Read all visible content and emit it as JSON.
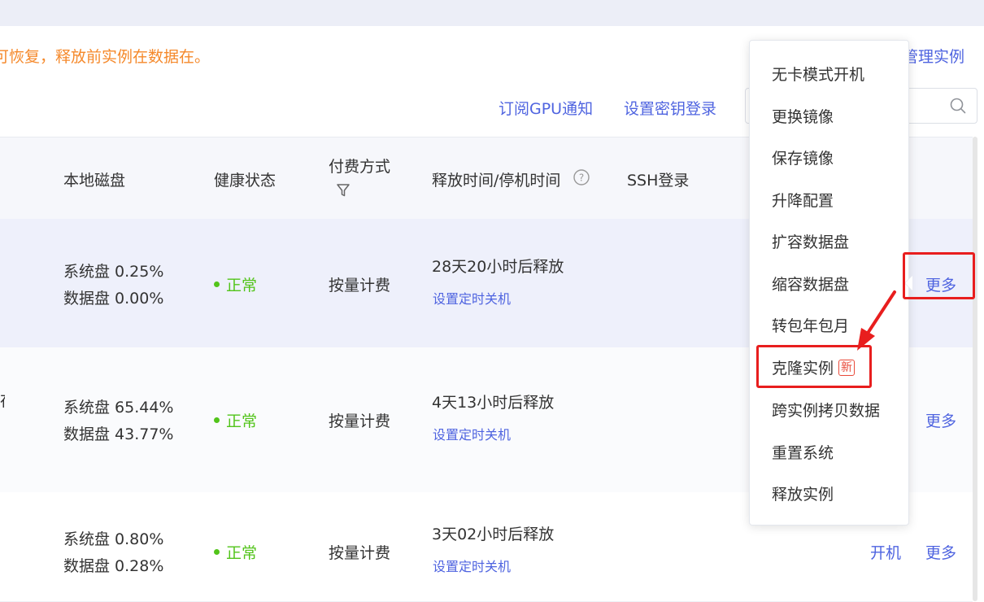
{
  "notice": {
    "text": "可恢复，释放前实例在数据在。"
  },
  "header": {
    "manage_link": "管理实例"
  },
  "toolbar": {
    "subscribe_gpu": "订阅GPU通知",
    "set_key_login": "设置密钥登录",
    "search": {
      "placeholder": ""
    }
  },
  "table": {
    "columns": {
      "local_disk": "本地磁盘",
      "health_status": "健康状态",
      "billing_line1": "付费方式",
      "release_time": "释放时间/停机时间",
      "ssh_login": "SSH登录"
    },
    "rows": [
      {
        "system_disk": "系统盘 0.25%",
        "data_disk": "数据盘 0.00%",
        "health": "正常",
        "billing": "按量计费",
        "release": "28天20小时后释放",
        "schedule_shutdown": "设置定时关机",
        "more": "更多"
      },
      {
        "edge_char": "存",
        "system_disk": "系统盘 65.44%",
        "data_disk": "数据盘 43.77%",
        "health": "正常",
        "billing": "按量计费",
        "release": "4天13小时后释放",
        "schedule_shutdown": "设置定时关机",
        "more": "更多"
      },
      {
        "system_disk": "系统盘 0.80%",
        "data_disk": "数据盘 0.28%",
        "health": "正常",
        "billing": "按量计费",
        "release": "3天02小时后释放",
        "schedule_shutdown": "设置定时关机",
        "power_on": "开机",
        "more": "更多"
      }
    ]
  },
  "dropdown": {
    "items": [
      "无卡模式开机",
      "更换镜像",
      "保存镜像",
      "升降配置",
      "扩容数据盘",
      "缩容数据盘",
      "转包年包月",
      "克隆实例",
      "跨实例拷贝数据",
      "重置系统",
      "释放实例"
    ],
    "new_badge": "新"
  },
  "colors": {
    "link": "#4f64e0",
    "warning": "#f5892b",
    "success": "#52c41a",
    "highlight": "#e81e1e"
  },
  "icons": {
    "search": "search-icon",
    "filter": "filter-icon",
    "help": "question-circle-icon"
  }
}
